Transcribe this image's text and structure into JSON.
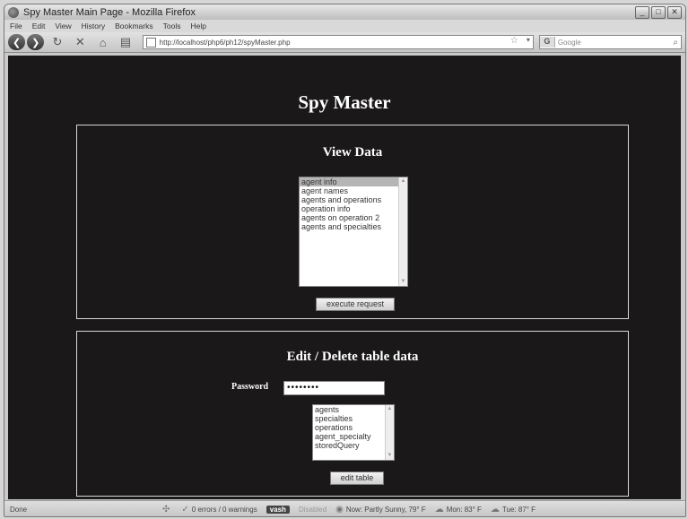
{
  "window": {
    "title": "Spy Master Main Page - Mozilla Firefox"
  },
  "menu": [
    "File",
    "Edit",
    "View",
    "History",
    "Bookmarks",
    "Tools",
    "Help"
  ],
  "nav": {
    "url": "http://localhost/php6/ph12/spyMaster.php",
    "search_placeholder": "Google"
  },
  "page": {
    "title": "Spy Master"
  },
  "view_data": {
    "title": "View Data",
    "options": [
      "agent info",
      "agent names",
      "agents and operations",
      "operation info",
      "agents on operation 2",
      "agents and specialties"
    ],
    "selected_index": 0,
    "button": "execute request"
  },
  "edit_data": {
    "title": "Edit / Delete table data",
    "password_label": "Password",
    "password_value": "••••••••",
    "options": [
      "agents",
      "specialties",
      "operations",
      "agent_specialty",
      "storedQuery"
    ],
    "button": "edit table"
  },
  "status": {
    "left": "Done",
    "errors": "0 errors / 0 warnings",
    "vash": "vash",
    "disabled": "Disabled",
    "weather_now": "Now: Partly Sunny, 79° F",
    "weather_mon": "Mon: 83° F",
    "weather_tue": "Tue: 87° F"
  }
}
